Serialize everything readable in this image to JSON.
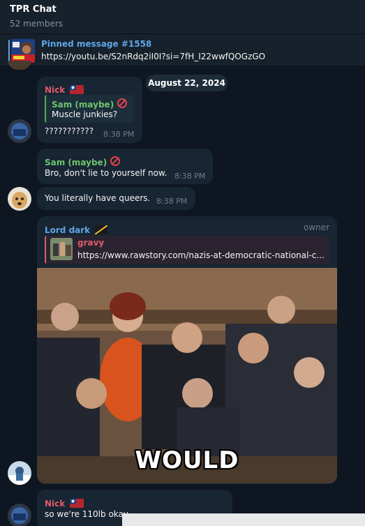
{
  "chat": {
    "title": "TPR Chat",
    "members": "52 members"
  },
  "pinned": {
    "title": "Pinned message #1558",
    "text": "https://youtu.be/S2nRdq2iI0I?si=7fH_I22wwfQOGzGO"
  },
  "date_separator": "August 22, 2024",
  "messages": [
    {
      "sender": "Nick",
      "sender_color": "#e05a6a",
      "reply_sender": "Sam (maybe)",
      "reply_text": "Muscle junkies?",
      "text": "???????????",
      "time": "8:38 PM"
    },
    {
      "sender": "Sam (maybe)",
      "sender_color": "#6ec46e",
      "text": "Bro, don't lie to yourself now.",
      "time": "8:38 PM"
    },
    {
      "text": "You literally have queers.",
      "time": "8:38 PM"
    },
    {
      "sender": "Lord dark",
      "sender_color": "#5ea6e6",
      "role": "owner",
      "preview_title": "gravy",
      "preview_text": "https://www.rawstory.com/nazis-at-democratic-national-c...",
      "photo_caption": "WOULD"
    },
    {
      "sender": "Nick",
      "text": "so we're 110lb okay"
    }
  ],
  "icons": {
    "no_entry": "no-entry-icon",
    "flag": "flag-icon",
    "scrollbar": "horizontal-scrollbar"
  }
}
